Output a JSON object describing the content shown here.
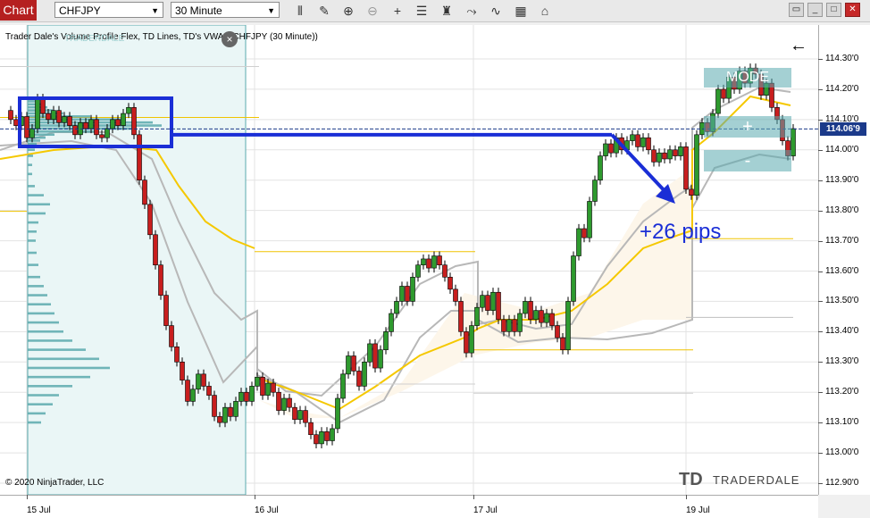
{
  "toolbar": {
    "tab_label": "Chart",
    "instrument": "CHFJPY",
    "timeframe": "30 Minute",
    "icons": [
      "bars-icon",
      "pencil-icon",
      "zoom-in-icon",
      "zoom-out-icon",
      "crosshair-icon",
      "properties-icon",
      "strategy-icon",
      "indicator-icon",
      "template-icon"
    ],
    "window_icons": [
      "restore-icon",
      "minimize-icon",
      "maximize-icon",
      "close-icon"
    ]
  },
  "chart": {
    "title": "Trader Dale's Volume Profile Flex, TD Lines, TD's VWAP(CHFJPY (30 Minute))",
    "copyright": "© 2020 NinjaTrader, LLC",
    "current_price": "114.06'9",
    "annotation": "+26 pips",
    "logo_text": "TRADERDALE",
    "logo_mark": "TD",
    "logo_small": "TRADERDALE",
    "vp_mode": "MODE",
    "vp_plus": "+",
    "vp_minus": "-",
    "close_symbol": "×",
    "back_arrow": "←"
  },
  "chart_data": {
    "type": "candlestick",
    "symbol": "CHFJPY",
    "interval": "30 Minute",
    "ylim": [
      112.87,
      114.33
    ],
    "yticks": [
      "114.30'0",
      "114.20'0",
      "114.10'0",
      "114.00'0",
      "113.90'0",
      "113.80'0",
      "113.70'0",
      "113.60'0",
      "113.50'0",
      "113.40'0",
      "113.30'0",
      "113.20'0",
      "113.10'0",
      "113.00'0",
      "112.90'0"
    ],
    "xticks": [
      "15 Jul",
      "16 Jul",
      "17 Jul",
      "19 Jul"
    ],
    "current_price": 114.069,
    "annotation": "+26 pips",
    "colors": {
      "up": "#2e9a2e",
      "down": "#c81e1e",
      "vwap": "#f5c800",
      "band": "#b8b8b8",
      "blue": "#1a2ed6",
      "profile": "#5aa9ad"
    }
  }
}
